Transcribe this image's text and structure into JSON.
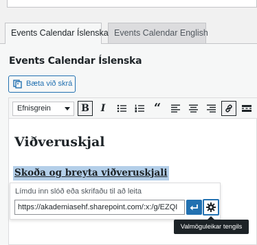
{
  "tabs": [
    {
      "label": "Events Calendar Íslenska",
      "active": true
    },
    {
      "label": "Events Calendar English",
      "active": false
    }
  ],
  "field": {
    "title": "Events Calendar Íslenska"
  },
  "add_media": {
    "label": "Bæta við skrá"
  },
  "toolbar": {
    "format_select": "Efnisgrein",
    "buttons": [
      "bold-icon",
      "italic-icon",
      "bulleted-list-icon",
      "numbered-list-icon",
      "blockquote-icon",
      "align-left-icon",
      "align-center-icon",
      "align-right-icon",
      "link-icon",
      "read-more-icon"
    ]
  },
  "content": {
    "heading": "Viðveruskjal",
    "link_text": "Skoða og breyta viðveruskjali"
  },
  "link_popup": {
    "hint": "Límdu inn slóð eða skrifaðu til að leita",
    "url_value": "https://akademiasehf.sharepoint.com/:x:/g/EZQI",
    "tooltip": "Valmöguleikar tengils"
  },
  "colors": {
    "accent": "#2271b1",
    "selection": "#b4cfe9",
    "tooltip_bg": "#1d2327"
  }
}
